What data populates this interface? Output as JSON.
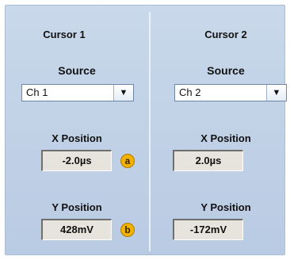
{
  "cursor1": {
    "title": "Cursor 1",
    "source_label": "Source",
    "source_value": "Ch 1",
    "x_label": "X Position",
    "x_value": "-2.0µs",
    "x_badge": "a",
    "y_label": "Y Position",
    "y_value": "428mV",
    "y_badge": "b"
  },
  "cursor2": {
    "title": "Cursor 2",
    "source_label": "Source",
    "source_value": "Ch 2",
    "x_label": "X Position",
    "x_value": "2.0µs",
    "y_label": "Y Position",
    "y_value": "-172mV"
  },
  "icons": {
    "dropdown": "▼"
  },
  "colors": {
    "panel_bg": "#c9d8ea",
    "badge": "#f2b200",
    "readout_bg": "#e6e4dc"
  }
}
